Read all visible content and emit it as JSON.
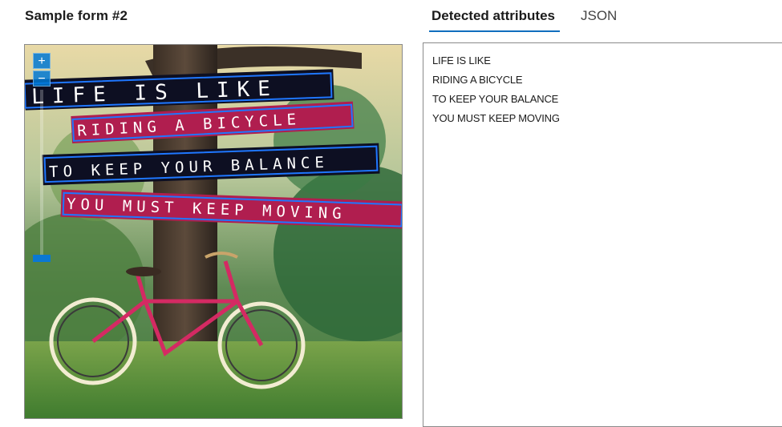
{
  "form": {
    "title": "Sample form #2"
  },
  "tabs": [
    {
      "label": "Detected attributes",
      "active": true
    },
    {
      "label": "JSON",
      "active": false
    }
  ],
  "zoom": {
    "in_label": "+",
    "out_label": "−",
    "icon_in": "plus-icon",
    "icon_out": "minus-icon"
  },
  "image": {
    "description_lines": [
      "LIFE IS LIKE",
      "RIDING A BICYCLE",
      "TO KEEP YOUR BALANCE",
      "YOU MUST KEEP MOVING"
    ],
    "colors": {
      "banner_dark": "#0d0f22",
      "banner_pink": "#b01e4f",
      "box_outline": "#1f77ff"
    }
  },
  "detected": {
    "lines": [
      "LIFE IS LIKE",
      "RIDING A BICYCLE",
      "TO KEEP YOUR BALANCE",
      "YOU MUST KEEP MOVING"
    ]
  },
  "colors": {
    "accent": "#106ebe"
  }
}
